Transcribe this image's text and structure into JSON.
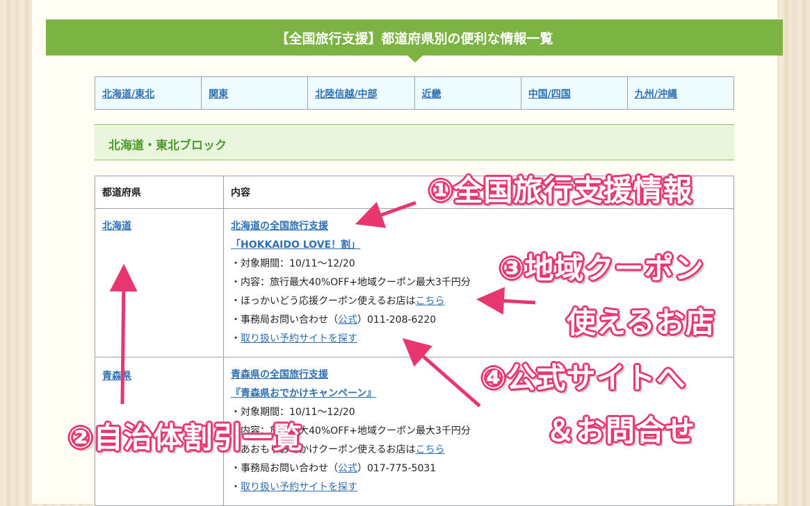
{
  "banner": {
    "title": "【全国旅行支援】都道府県別の便利な情報一覧"
  },
  "regions": [
    "北海道/東北",
    "関東",
    "北陸信越/中部",
    "近畿",
    "中国/四国",
    "九州/沖縄"
  ],
  "block_heading": "北海道・東北ブロック",
  "table": {
    "headers": [
      "都道府県",
      "内容"
    ],
    "rows": [
      {
        "prefecture": "北海道",
        "title": "北海道の全国旅行支援",
        "campaign": "「HOKKAIDO LOVE！割」",
        "period": "・対象期間：10/11〜12/20",
        "content": "・内容：旅行最大40%OFF+地域クーポン最大3千円分",
        "shops_prefix": "・ほっかいどう応援クーポン使えるお店は",
        "shops_link": "こちら",
        "contact_prefix": "・事務局お問い合わせ（",
        "contact_link": "公式",
        "contact_suffix": "）011-208-6220",
        "booking_prefix": "・",
        "booking_link": "取り扱い予約サイトを探す"
      },
      {
        "prefecture": "青森県",
        "title": "青森県の全国旅行支援",
        "campaign": "『青森県おでかけキャンペーン』",
        "period": "・対象期間：10/11〜12/20",
        "content": "・内容：旅行最大40%OFF+地域クーポン最大3千円分",
        "shops_prefix": "・あおもりおでかけクーポン使えるお店は",
        "shops_link": "こちら",
        "contact_prefix": "・事務局お問い合わせ（",
        "contact_link": "公式",
        "contact_suffix": "）017-775-5031",
        "booking_prefix": "・",
        "booking_link": "取り扱い予約サイトを探す"
      }
    ]
  },
  "annotations": {
    "a1": "①全国旅行支援情報",
    "a2": "②自治体割引一覧",
    "a3_line1": "③地域クーポン",
    "a3_line2": "使えるお店",
    "a4_line1": "④公式サイトへ",
    "a4_line2": "＆お問合せ"
  },
  "colors": {
    "banner": "#7bb443",
    "link": "#2f6fb2",
    "annotation": "#e8366f",
    "heading_text": "#4c9a2e"
  }
}
